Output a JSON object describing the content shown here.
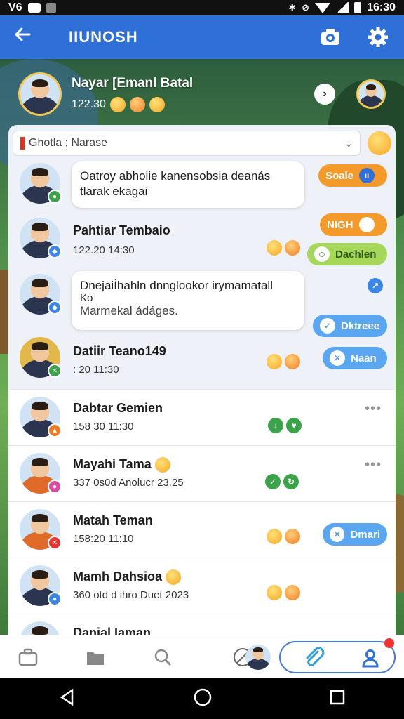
{
  "status_bar": {
    "left_text": "V6",
    "time": "16:30"
  },
  "app_bar": {
    "title": "IIUNOSH"
  },
  "header_user": {
    "name": "Nayar [Emanl Batal",
    "meta": "122.30"
  },
  "search": {
    "value": "Ghotla ; Narase"
  },
  "rows": [
    {
      "type": "bubble",
      "text_line1": "Oatroy abhoiie kanensobsia deanás",
      "text_line2": "tlarak ekagai",
      "pill": "Soale"
    },
    {
      "type": "contact",
      "name": "Pahtiar Tembaio",
      "sub": "122.20  14:30",
      "pill1": "NIGH",
      "pill2": "Dachlen"
    },
    {
      "type": "bubble",
      "text_line1": "Dnejaiİhahln dnnglookor irymamatall",
      "text_line2": "Ko",
      "text_line3": "Marmekal ádáges.",
      "pill": "Dktreee"
    },
    {
      "type": "contact",
      "name": "Datiir Teano149",
      "sub": ": 20  11:30",
      "pill": "Naan"
    },
    {
      "type": "contact",
      "name": "Dabtar Gemien",
      "sub": "158 30  11:30"
    },
    {
      "type": "contact",
      "name": "Mayahi Tama",
      "sub": "337 0s0d Anolucr 23.25"
    },
    {
      "type": "contact",
      "name": "Matah Teman",
      "sub": "158:20  11:10",
      "pill": "Dmari"
    },
    {
      "type": "contact",
      "name": "Mamh Dahsioa",
      "sub": "360 otd d ihro Duet 2023"
    },
    {
      "type": "contact",
      "name": "Danial Iaman"
    }
  ],
  "colors": {
    "app_bar": "#2f6fd8",
    "accent_orange": "#f39a2b",
    "accent_blue": "#5aa6f0",
    "accent_green": "#a6d65a"
  }
}
